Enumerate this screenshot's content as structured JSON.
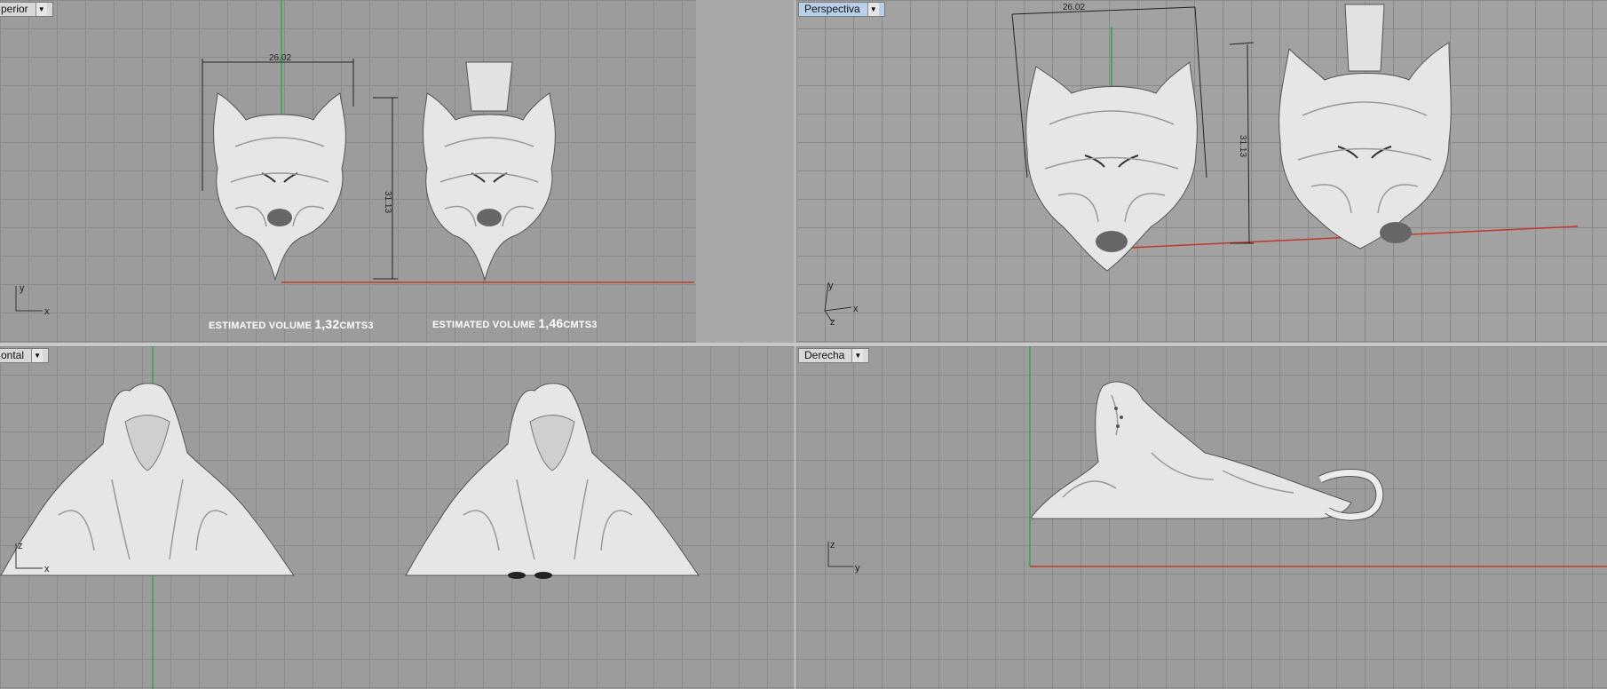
{
  "viewports": {
    "top": {
      "label": "perior"
    },
    "persp": {
      "label": "Perspectiva"
    },
    "front": {
      "label": "ontal"
    },
    "right": {
      "label": "Derecha"
    }
  },
  "dimensions": {
    "width": "26.02",
    "height": "31.13"
  },
  "volumes": {
    "left_prefix": "ESTIMATED VOLUME ",
    "left_value": "1,32",
    "left_unit": "CMTS3",
    "right_prefix": "ESTIMATED VOLUME ",
    "right_value": "1,46",
    "right_unit": "CMTS3"
  },
  "axes": {
    "top": {
      "a": "y",
      "b": "x"
    },
    "persp": {
      "a": "y",
      "b": "x",
      "c": "z"
    },
    "front": {
      "a": "z",
      "b": "x"
    },
    "right": {
      "a": "z",
      "b": "y"
    }
  },
  "colors": {
    "grid_bg": "#9c9c9c",
    "grid_line": "#8a8a8a",
    "axis_green": "#2fa84a",
    "axis_red": "#c0392b",
    "active_tab": "#b9d0ea",
    "model": "#e8e8e8"
  }
}
